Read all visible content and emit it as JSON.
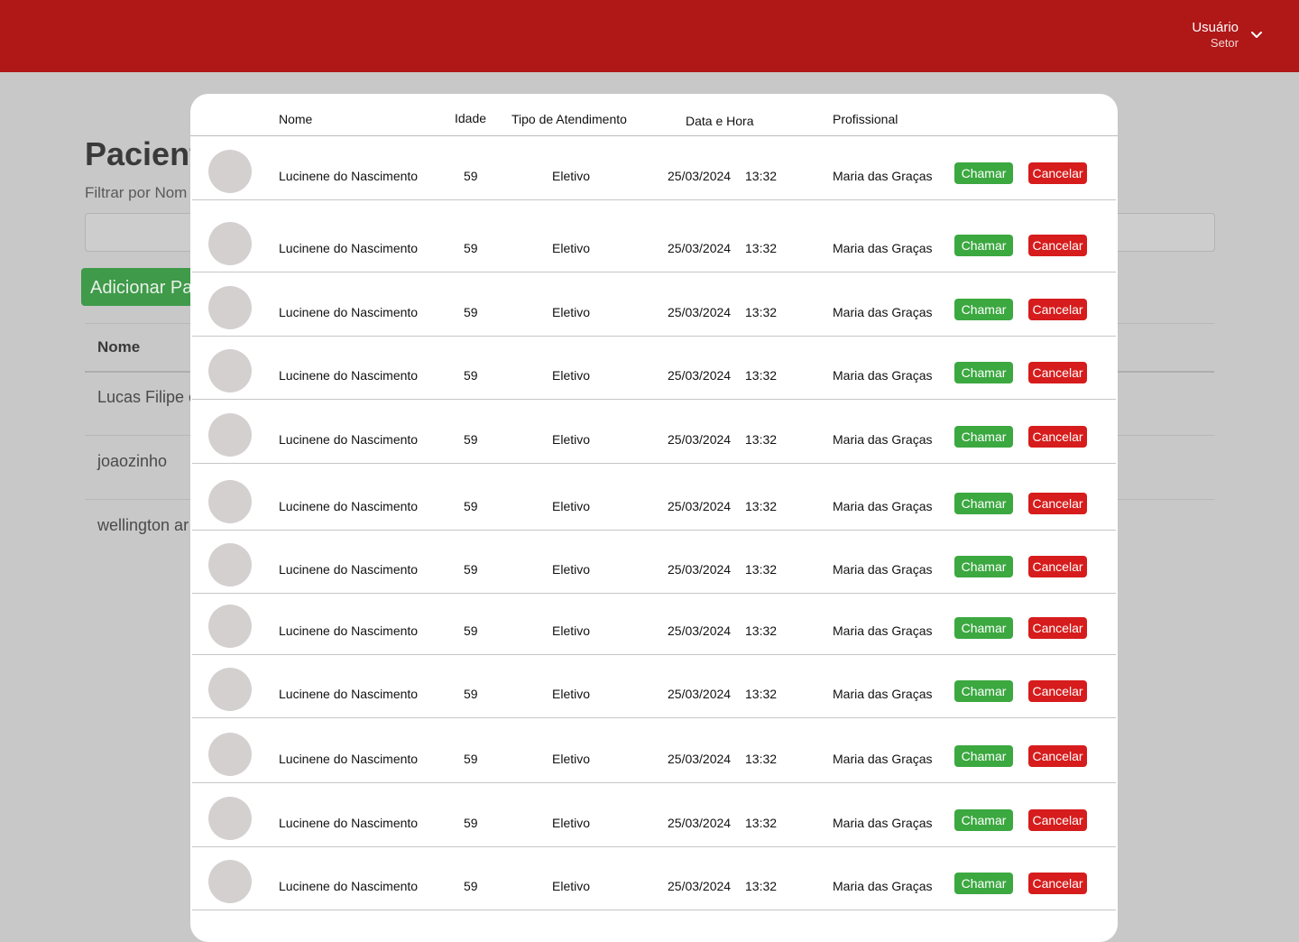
{
  "header": {
    "user_name": "Usuário",
    "user_sector": "Setor",
    "chevron_icon": "chevron-down-icon",
    "bar_color": "#b01717"
  },
  "background_page": {
    "title": "Pacient",
    "filter_label": "Filtrar por Nom",
    "add_button": "Adicionar Pa",
    "table_header_nome": "Nome",
    "rows": [
      "Lucas Filipe c",
      "joaozinho",
      "wellington ar"
    ]
  },
  "modal": {
    "headers": {
      "nome": "Nome",
      "idade": "Idade",
      "tipo": "Tipo de Atendimento",
      "data_hora": "Data e Hora",
      "profissional": "Profissional"
    },
    "rows": [
      {
        "nome": "Lucinene do Nascimento",
        "idade": "59",
        "tipo": "Eletivo",
        "data": "25/03/2024",
        "hora": "13:32",
        "profissional": "Maria das Graças",
        "chamar": "Chamar",
        "cancelar": "Cancelar"
      },
      {
        "nome": "Lucinene do Nascimento",
        "idade": "59",
        "tipo": "Eletivo",
        "data": "25/03/2024",
        "hora": "13:32",
        "profissional": "Maria das Graças",
        "chamar": "Chamar",
        "cancelar": "Cancelar"
      },
      {
        "nome": "Lucinene do Nascimento",
        "idade": "59",
        "tipo": "Eletivo",
        "data": "25/03/2024",
        "hora": "13:32",
        "profissional": "Maria das Graças",
        "chamar": "Chamar",
        "cancelar": "Cancelar"
      },
      {
        "nome": "Lucinene do Nascimento",
        "idade": "59",
        "tipo": "Eletivo",
        "data": "25/03/2024",
        "hora": "13:32",
        "profissional": "Maria das Graças",
        "chamar": "Chamar",
        "cancelar": "Cancelar"
      },
      {
        "nome": "Lucinene do Nascimento",
        "idade": "59",
        "tipo": "Eletivo",
        "data": "25/03/2024",
        "hora": "13:32",
        "profissional": "Maria das Graças",
        "chamar": "Chamar",
        "cancelar": "Cancelar"
      },
      {
        "nome": "Lucinene do Nascimento",
        "idade": "59",
        "tipo": "Eletivo",
        "data": "25/03/2024",
        "hora": "13:32",
        "profissional": "Maria das Graças",
        "chamar": "Chamar",
        "cancelar": "Cancelar"
      },
      {
        "nome": "Lucinene do Nascimento",
        "idade": "59",
        "tipo": "Eletivo",
        "data": "25/03/2024",
        "hora": "13:32",
        "profissional": "Maria das Graças",
        "chamar": "Chamar",
        "cancelar": "Cancelar"
      },
      {
        "nome": "Lucinene do Nascimento",
        "idade": "59",
        "tipo": "Eletivo",
        "data": "25/03/2024",
        "hora": "13:32",
        "profissional": "Maria das Graças",
        "chamar": "Chamar",
        "cancelar": "Cancelar"
      },
      {
        "nome": "Lucinene do Nascimento",
        "idade": "59",
        "tipo": "Eletivo",
        "data": "25/03/2024",
        "hora": "13:32",
        "profissional": "Maria das Graças",
        "chamar": "Chamar",
        "cancelar": "Cancelar"
      },
      {
        "nome": "Lucinene do Nascimento",
        "idade": "59",
        "tipo": "Eletivo",
        "data": "25/03/2024",
        "hora": "13:32",
        "profissional": "Maria das Graças",
        "chamar": "Chamar",
        "cancelar": "Cancelar"
      },
      {
        "nome": "Lucinene do Nascimento",
        "idade": "59",
        "tipo": "Eletivo",
        "data": "25/03/2024",
        "hora": "13:32",
        "profissional": "Maria das Graças",
        "chamar": "Chamar",
        "cancelar": "Cancelar"
      },
      {
        "nome": "Lucinene do Nascimento",
        "idade": "59",
        "tipo": "Eletivo",
        "data": "25/03/2024",
        "hora": "13:32",
        "profissional": "Maria das Graças",
        "chamar": "Chamar",
        "cancelar": "Cancelar"
      }
    ],
    "colors": {
      "chamar": "#3ba840",
      "cancelar": "#d61c1c",
      "avatar": "#d4d0d0"
    }
  }
}
